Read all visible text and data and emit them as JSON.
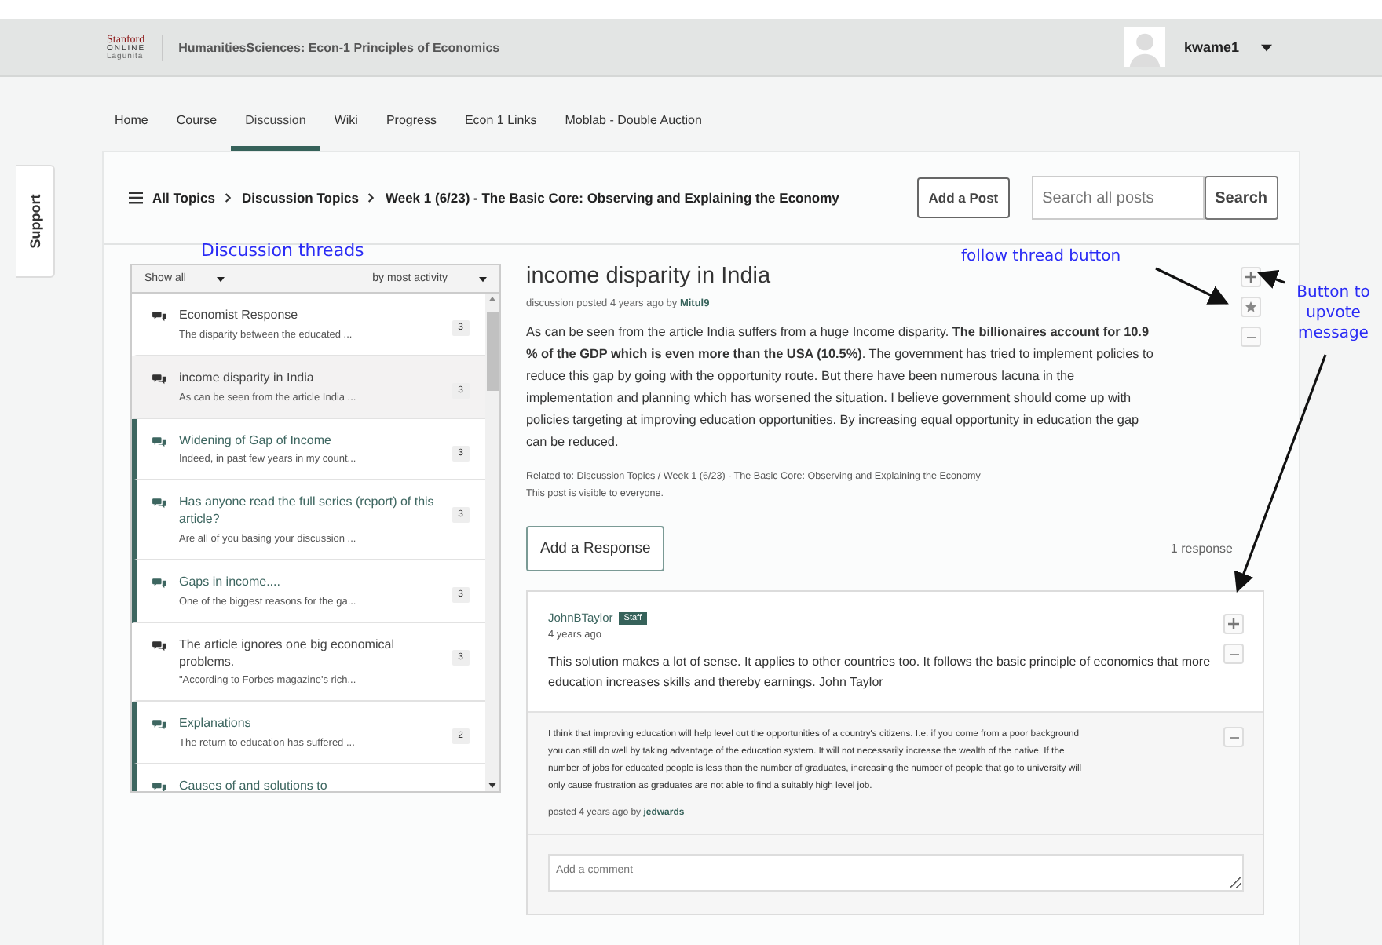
{
  "header": {
    "logo": [
      "Stanford",
      "ONLINE",
      "Lagunita"
    ],
    "course_title": "HumanitiesSciences: Econ-1 Principles of Economics",
    "username": "kwame1"
  },
  "nav_tabs": [
    {
      "label": "Home",
      "selected": false
    },
    {
      "label": "Course",
      "selected": false
    },
    {
      "label": "Discussion",
      "selected": true
    },
    {
      "label": "Wiki",
      "selected": false
    },
    {
      "label": "Progress",
      "selected": false
    },
    {
      "label": "Econ 1 Links",
      "selected": false
    },
    {
      "label": "Moblab - Double Auction",
      "selected": false
    }
  ],
  "support_tab": "Support",
  "breadcrumb": [
    "All Topics",
    "Discussion Topics",
    "Week 1 (6/23) - The Basic Core: Observing and Explaining the Economy"
  ],
  "add_post": "Add a Post",
  "search": {
    "placeholder": "Search all posts",
    "button": "Search"
  },
  "filters": {
    "show": "Show all",
    "sort": "by most activity"
  },
  "threads": [
    {
      "title": "Economist Response",
      "preview": "The disparity between the educated ...",
      "count": "3",
      "selected": false,
      "unread": false
    },
    {
      "title": "income disparity in India",
      "preview": "As can be seen from the article India ...",
      "count": "3",
      "selected": true,
      "unread": false
    },
    {
      "title": "Widening of Gap of Income",
      "preview": "Indeed, in past few years in my count...",
      "count": "3",
      "selected": false,
      "unread": true
    },
    {
      "title": "Has anyone read the full series (report) of this article?",
      "preview": "Are all of you basing your discussion ...",
      "count": "3",
      "selected": false,
      "unread": true
    },
    {
      "title": "Gaps in income....",
      "preview": "One of the biggest reasons for the ga...",
      "count": "3",
      "selected": false,
      "unread": true
    },
    {
      "title": "The article ignores one big economical problems.",
      "preview": "\"According to Forbes magazine's rich...",
      "count": "3",
      "selected": false,
      "unread": false
    },
    {
      "title": "Explanations",
      "preview": "The return to education has suffered ...",
      "count": "2",
      "selected": false,
      "unread": true
    },
    {
      "title": "Causes of and solutions to",
      "selected": false,
      "unread": true
    }
  ],
  "post": {
    "title": "income disparity in India",
    "meta": "discussion posted 4 years ago by",
    "author": "Mitul9",
    "body": "As can be seen from the article India suffers from a huge Income disparity. **The billionaires account for 10.9 % of the GDP which is even more than the USA (10.5%)**. The government has tried to implement policies to reduce this gap by going with the opportunity route. But there have been numerous lacuna in the implementation and planning which has worsened the situation. I believe government should come up with policies targeting at improving education opportunities. By increasing equal opportunity in education the gap can be reduced.",
    "related": "Related to: Discussion Topics / Week 1 (6/23) - The Basic Core: Observing and Explaining the Economy",
    "visibility": "This post is visible to everyone.",
    "add_response": "Add a Response",
    "response_count": "1 response"
  },
  "response": {
    "author": "JohnBTaylor",
    "badge": "Staff",
    "time": "4 years ago",
    "body": "This solution makes a lot of sense. It applies to other countries too. It follows the basic principle of economics that more education increases skills and thereby earnings. John Taylor"
  },
  "comment": {
    "body": "I think that improving education will help level out the opportunities of a country's citizens. I.e. if you come from a poor background you can still do well by taking advantage of the education system. It will not necessarily increase the wealth of the native. If the number of jobs for educated people is less than the number of graduates, increasing the number of people that go to university will only cause frustration as graduates are not able to find a suitably high level job.",
    "meta": "posted 4 years ago by",
    "author": "jedwards"
  },
  "comment_field": {
    "placeholder": "Add a comment"
  },
  "annotations": [
    "Discussion threads",
    "follow thread button",
    "Button to upvote message"
  ]
}
